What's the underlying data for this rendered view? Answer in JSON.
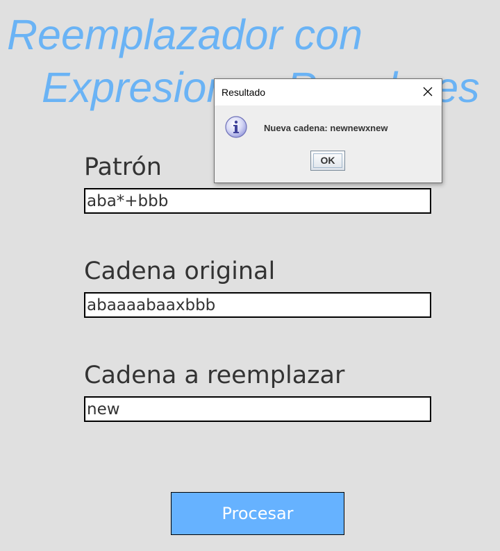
{
  "app": {
    "title_line_1": "Reemplazador con",
    "title_line_2": "Expresiones Regulares"
  },
  "form": {
    "pattern": {
      "label": "Patrón",
      "value": "aba*+bbb"
    },
    "original": {
      "label": "Cadena original",
      "value": "abaaaabaaxbbb"
    },
    "replacement": {
      "label": "Cadena a reemplazar",
      "value": "new"
    },
    "process_label": "Procesar"
  },
  "dialog": {
    "title": "Resultado",
    "message": "Nueva cadena: newnewxnew",
    "ok_label": "OK",
    "icons": {
      "info": "info-icon",
      "close": "close-icon"
    }
  },
  "colors": {
    "background": "#e0e0e0",
    "title": "#6ab3f5",
    "button": "#66b2ff",
    "button_text": "#ffffff",
    "text": "#333333"
  }
}
